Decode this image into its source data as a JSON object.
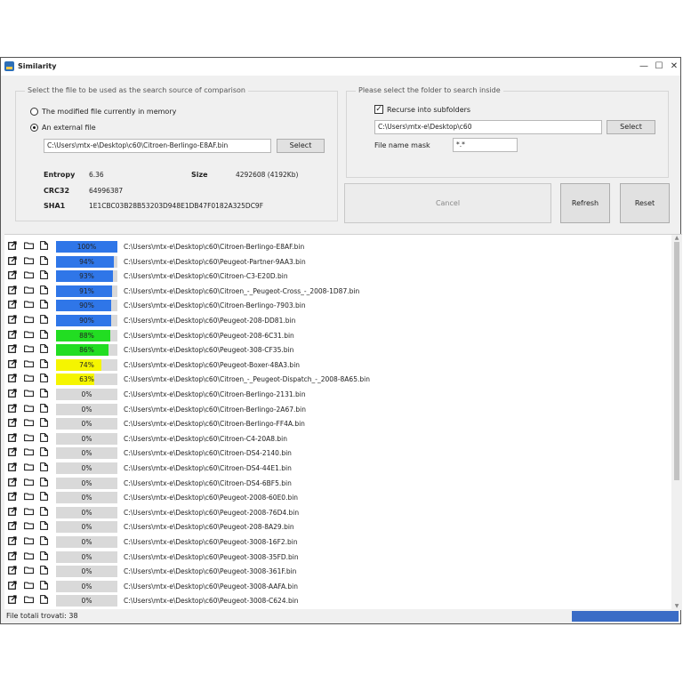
{
  "window": {
    "title": "Similarity",
    "controls": [
      "minimize-icon",
      "maximize-icon",
      "close-icon"
    ]
  },
  "source_group": {
    "title": "Select the file to be used as the search source of comparison",
    "option_memory": "The modified file currently in memory",
    "option_external": "An external file",
    "selected_option": "external",
    "file_path": "C:\\Users\\mtx-e\\Desktop\\c60\\Citroen-Berlingo-E8AF.bin",
    "select_label": "Select",
    "entropy_label": "Entropy",
    "entropy_value": "6.36",
    "size_label": "Size",
    "size_value": "4292608 (4192Kb)",
    "crc_label": "CRC32",
    "crc_value": "64996387",
    "sha_label": "SHA1",
    "sha_value": "1E1CBC03B28B53203D948E1DB47F0182A325DC9F"
  },
  "folder_group": {
    "title": "Please select the folder to search inside",
    "recurse_label": "Recurse into subfolders",
    "recurse_checked": true,
    "folder_path": "C:\\Users\\mtx-e\\Desktop\\c60",
    "select_label": "Select",
    "mask_label": "File name mask",
    "mask_value": "*.*"
  },
  "actions": {
    "cancel": "Cancel",
    "refresh": "Refresh",
    "reset": "Reset"
  },
  "results": [
    {
      "pct": "100%",
      "value": 1.0,
      "color": "#2f76e8",
      "path": "C:\\Users\\mtx-e\\Desktop\\c60\\Citroen-Berlingo-E8AF.bin"
    },
    {
      "pct": "94%",
      "value": 0.94,
      "color": "#2f76e8",
      "path": "C:\\Users\\mtx-e\\Desktop\\c60\\Peugeot-Partner-9AA3.bin"
    },
    {
      "pct": "93%",
      "value": 0.93,
      "color": "#2f76e8",
      "path": "C:\\Users\\mtx-e\\Desktop\\c60\\Citroen-C3-E20D.bin"
    },
    {
      "pct": "91%",
      "value": 0.91,
      "color": "#2f76e8",
      "path": "C:\\Users\\mtx-e\\Desktop\\c60\\Citroen_-_Peugeot-Cross_-_2008-1D87.bin"
    },
    {
      "pct": "90%",
      "value": 0.9,
      "color": "#2f76e8",
      "path": "C:\\Users\\mtx-e\\Desktop\\c60\\Citroen-Berlingo-7903.bin"
    },
    {
      "pct": "90%",
      "value": 0.9,
      "color": "#2f76e8",
      "path": "C:\\Users\\mtx-e\\Desktop\\c60\\Peugeot-208-DD81.bin"
    },
    {
      "pct": "88%",
      "value": 0.88,
      "color": "#22dd22",
      "path": "C:\\Users\\mtx-e\\Desktop\\c60\\Peugeot-208-6C31.bin"
    },
    {
      "pct": "86%",
      "value": 0.86,
      "color": "#22dd22",
      "path": "C:\\Users\\mtx-e\\Desktop\\c60\\Peugeot-308-CF35.bin"
    },
    {
      "pct": "74%",
      "value": 0.74,
      "color": "#f5f500",
      "path": "C:\\Users\\mtx-e\\Desktop\\c60\\Peugeot-Boxer-48A3.bin"
    },
    {
      "pct": "63%",
      "value": 0.63,
      "color": "#f5f500",
      "path": "C:\\Users\\mtx-e\\Desktop\\c60\\Citroen_-_Peugeot-Dispatch_-_2008-8A65.bin"
    },
    {
      "pct": "0%",
      "value": 0,
      "color": "#d9d9d9",
      "path": "C:\\Users\\mtx-e\\Desktop\\c60\\Citroen-Berlingo-2131.bin"
    },
    {
      "pct": "0%",
      "value": 0,
      "color": "#d9d9d9",
      "path": "C:\\Users\\mtx-e\\Desktop\\c60\\Citroen-Berlingo-2A67.bin"
    },
    {
      "pct": "0%",
      "value": 0,
      "color": "#d9d9d9",
      "path": "C:\\Users\\mtx-e\\Desktop\\c60\\Citroen-Berlingo-FF4A.bin"
    },
    {
      "pct": "0%",
      "value": 0,
      "color": "#d9d9d9",
      "path": "C:\\Users\\mtx-e\\Desktop\\c60\\Citroen-C4-20A8.bin"
    },
    {
      "pct": "0%",
      "value": 0,
      "color": "#d9d9d9",
      "path": "C:\\Users\\mtx-e\\Desktop\\c60\\Citroen-DS4-2140.bin"
    },
    {
      "pct": "0%",
      "value": 0,
      "color": "#d9d9d9",
      "path": "C:\\Users\\mtx-e\\Desktop\\c60\\Citroen-DS4-44E1.bin"
    },
    {
      "pct": "0%",
      "value": 0,
      "color": "#d9d9d9",
      "path": "C:\\Users\\mtx-e\\Desktop\\c60\\Citroen-DS4-6BF5.bin"
    },
    {
      "pct": "0%",
      "value": 0,
      "color": "#d9d9d9",
      "path": "C:\\Users\\mtx-e\\Desktop\\c60\\Peugeot-2008-60E0.bin"
    },
    {
      "pct": "0%",
      "value": 0,
      "color": "#d9d9d9",
      "path": "C:\\Users\\mtx-e\\Desktop\\c60\\Peugeot-2008-76D4.bin"
    },
    {
      "pct": "0%",
      "value": 0,
      "color": "#d9d9d9",
      "path": "C:\\Users\\mtx-e\\Desktop\\c60\\Peugeot-208-8A29.bin"
    },
    {
      "pct": "0%",
      "value": 0,
      "color": "#d9d9d9",
      "path": "C:\\Users\\mtx-e\\Desktop\\c60\\Peugeot-3008-16F2.bin"
    },
    {
      "pct": "0%",
      "value": 0,
      "color": "#d9d9d9",
      "path": "C:\\Users\\mtx-e\\Desktop\\c60\\Peugeot-3008-35FD.bin"
    },
    {
      "pct": "0%",
      "value": 0,
      "color": "#d9d9d9",
      "path": "C:\\Users\\mtx-e\\Desktop\\c60\\Peugeot-3008-361F.bin"
    },
    {
      "pct": "0%",
      "value": 0,
      "color": "#d9d9d9",
      "path": "C:\\Users\\mtx-e\\Desktop\\c60\\Peugeot-3008-AAFA.bin"
    },
    {
      "pct": "0%",
      "value": 0,
      "color": "#d9d9d9",
      "path": "C:\\Users\\mtx-e\\Desktop\\c60\\Peugeot-3008-C624.bin"
    }
  ],
  "row_icons": [
    "open-external-icon",
    "folder-icon",
    "file-icon"
  ],
  "status": {
    "text": "File totali trovati: 38",
    "progress": 1.0,
    "progress_color": "#3a6cc6"
  }
}
